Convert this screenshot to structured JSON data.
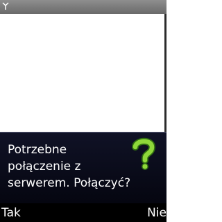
{
  "status_bar": {
    "signal_icon": "antenna-icon"
  },
  "dialog": {
    "message": "Potrzebne\npołączenie z\nserwerem. Połączyć?",
    "icon": "question-mark-icon",
    "icon_color": "#7ed321"
  },
  "softkeys": {
    "left_label": "Tak",
    "right_label": "Nie"
  }
}
